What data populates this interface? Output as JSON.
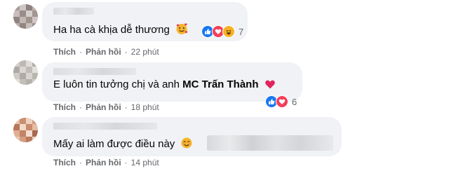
{
  "comments": [
    {
      "text": "Ha ha cà khịa dễ thương",
      "emoji": "smiling-face-with-hearts",
      "reactions": [
        "like",
        "love",
        "haha"
      ],
      "reaction_count": "7",
      "actions": {
        "like": "Thích",
        "reply": "Phản hồi",
        "time": "22 phút"
      }
    },
    {
      "text_prefix": "E luôn tin tưởng chị và anh ",
      "text_bold": "MC Trấn Thành",
      "emoji": "red-heart",
      "reactions": [
        "like",
        "love"
      ],
      "reaction_count": "6",
      "actions": {
        "like": "Thích",
        "reply": "Phản hồi",
        "time": "18 phút"
      }
    },
    {
      "text": "Mấy ai làm được điều này",
      "emoji": "smiling-face",
      "actions": {
        "like": "Thích",
        "reply": "Phản hồi",
        "time": "14 phút"
      }
    }
  ],
  "separator": "·",
  "colors": {
    "bubble": "#f0f2f5",
    "text": "#050505",
    "meta": "#65676b",
    "like": "#1877f2",
    "love": "#f33e58",
    "haha": "#f7b125"
  }
}
